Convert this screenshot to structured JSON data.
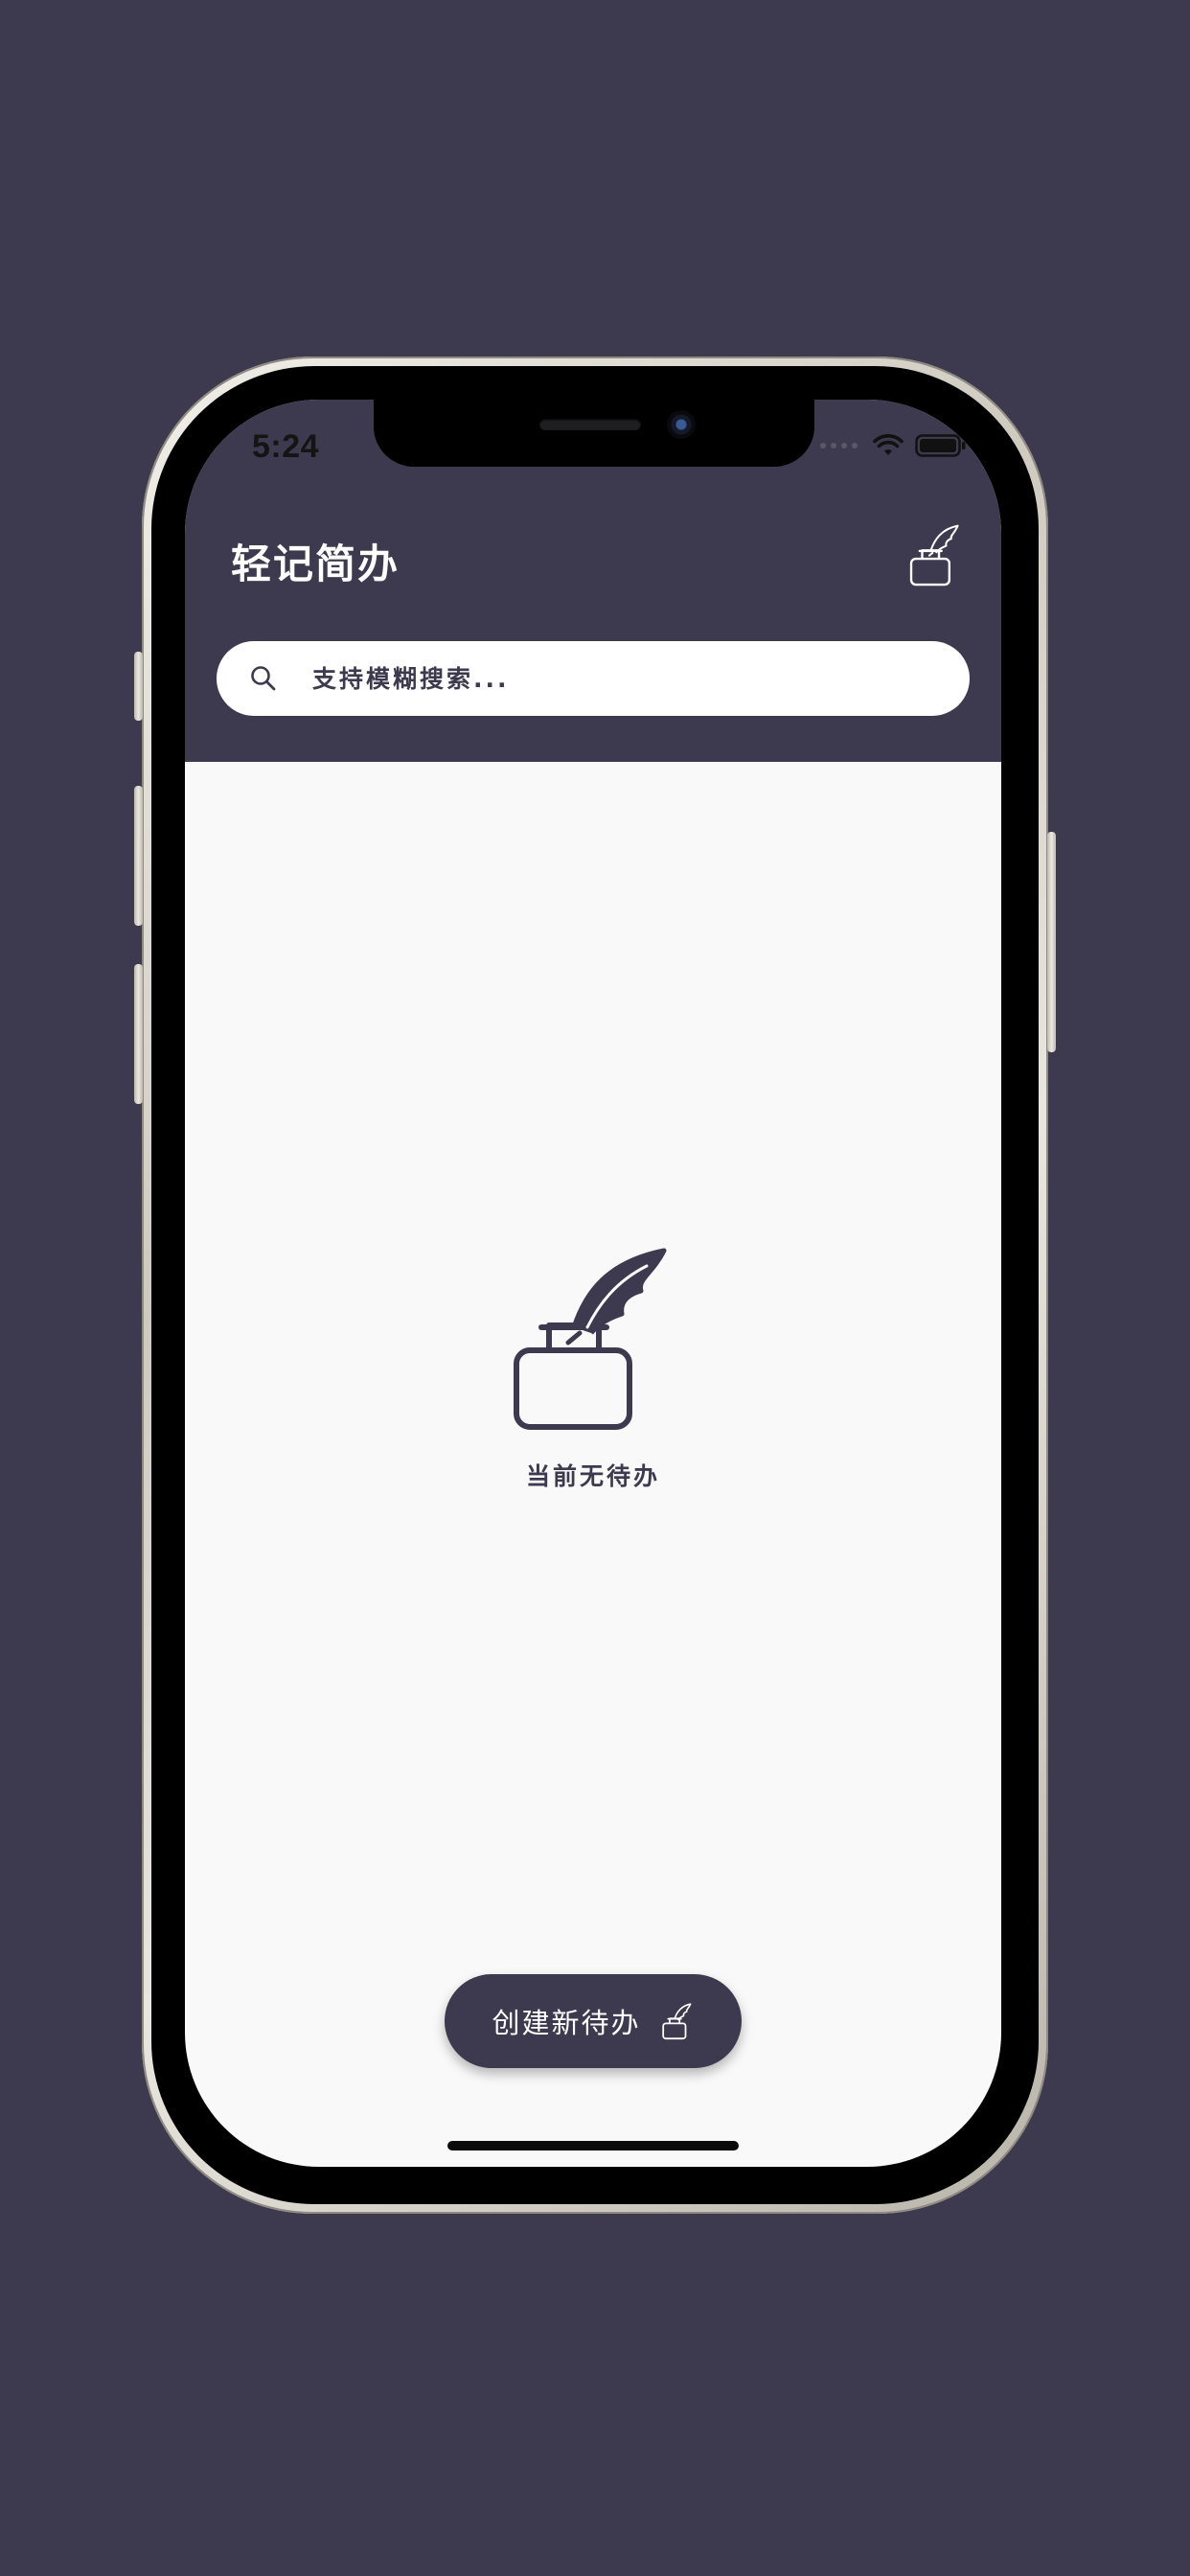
{
  "status_bar": {
    "time": "5:24",
    "icons": [
      "signal-icon",
      "wifi-icon",
      "battery-icon"
    ]
  },
  "header": {
    "title": "轻记简办",
    "action_icon": "ink-quill-icon"
  },
  "search": {
    "placeholder": "支持模糊搜索...",
    "value": "",
    "icon": "search-icon"
  },
  "empty_state": {
    "icon": "ink-quill-icon",
    "message": "当前无待办"
  },
  "create_button": {
    "label": "创建新待办",
    "icon": "ink-quill-icon"
  },
  "colors": {
    "primary": "#3d3a4f",
    "content_background": "#f9f9f9",
    "on_primary": "#ffffff"
  }
}
